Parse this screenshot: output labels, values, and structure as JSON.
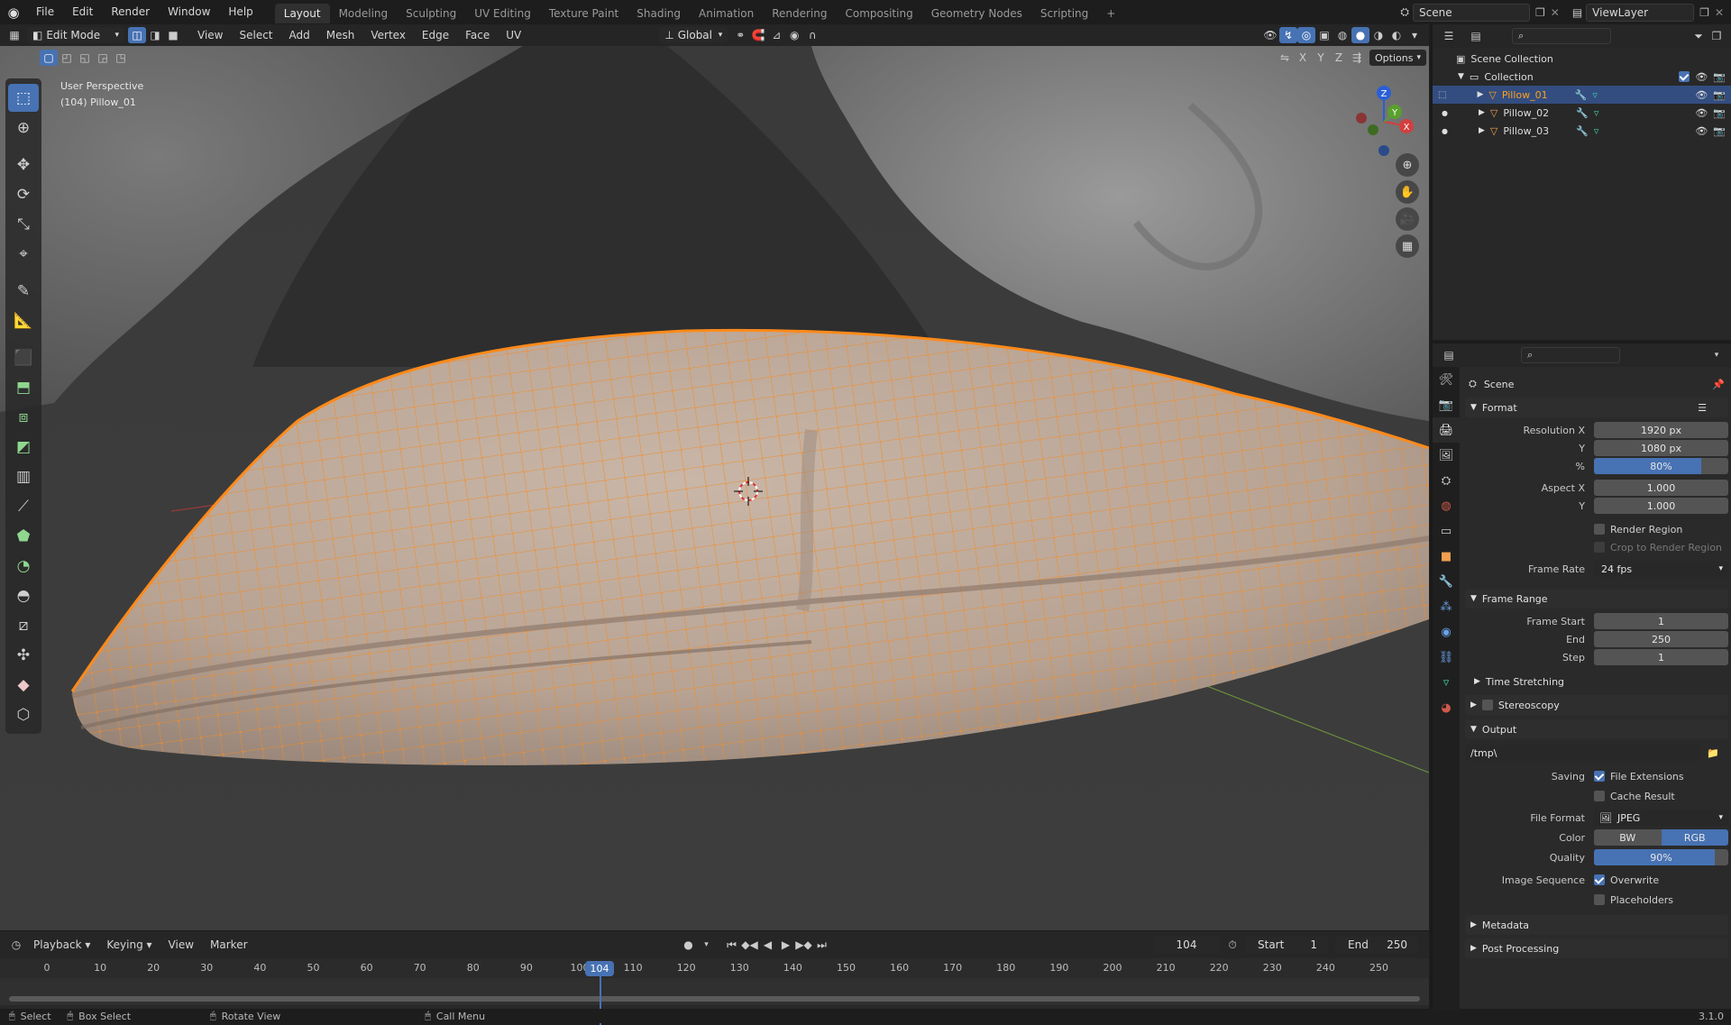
{
  "topbar": {
    "menus": [
      "File",
      "Edit",
      "Render",
      "Window",
      "Help"
    ],
    "workspaces": [
      "Layout",
      "Modeling",
      "Sculpting",
      "UV Editing",
      "Texture Paint",
      "Shading",
      "Animation",
      "Rendering",
      "Compositing",
      "Geometry Nodes",
      "Scripting"
    ],
    "active_workspace": "Layout",
    "add_tab": "+",
    "scene_name": "Scene",
    "view_layer": "ViewLayer"
  },
  "viewport": {
    "mode": "Edit Mode",
    "menus": [
      "View",
      "Select",
      "Add",
      "Mesh",
      "Vertex",
      "Edge",
      "Face",
      "UV"
    ],
    "transform_orientation": "Global",
    "options_label": "Options",
    "axis_lock": [
      "X",
      "Y",
      "Z"
    ],
    "info_line1": "User Perspective",
    "info_line2": "(104) Pillow_01",
    "gizmo_labels": {
      "z": "Z",
      "y": "Y",
      "x": "X"
    }
  },
  "outliner": {
    "scene_collection": "Scene Collection",
    "collection": "Collection",
    "objects": [
      "Pillow_01",
      "Pillow_02",
      "Pillow_03"
    ],
    "selected": "Pillow_01"
  },
  "properties": {
    "context": "Scene",
    "format": {
      "title": "Format",
      "resolution_x_label": "Resolution X",
      "resolution_x": "1920 px",
      "resolution_y_label": "Y",
      "resolution_y": "1080 px",
      "percent_label": "%",
      "percent": "80%",
      "percent_fill": 0.8,
      "aspect_x_label": "Aspect X",
      "aspect_x": "1.000",
      "aspect_y_label": "Y",
      "aspect_y": "1.000",
      "render_region": "Render Region",
      "crop_region": "Crop to Render Region",
      "frame_rate_label": "Frame Rate",
      "frame_rate": "24 fps"
    },
    "frame_range": {
      "title": "Frame Range",
      "start_label": "Frame Start",
      "start": "1",
      "end_label": "End",
      "end": "250",
      "step_label": "Step",
      "step": "1",
      "time_stretching": "Time Stretching"
    },
    "stereoscopy": "Stereoscopy",
    "output": {
      "title": "Output",
      "path": "/tmp\\",
      "saving_label": "Saving",
      "file_extensions": "File Extensions",
      "cache_result": "Cache Result",
      "file_format_label": "File Format",
      "file_format": "JPEG",
      "color_label": "Color",
      "color_bw": "BW",
      "color_rgb": "RGB",
      "quality_label": "Quality",
      "quality": "90%",
      "quality_fill": 0.9,
      "image_sequence_label": "Image Sequence",
      "overwrite": "Overwrite",
      "placeholders": "Placeholders"
    },
    "metadata": "Metadata",
    "post_processing": "Post Processing"
  },
  "timeline": {
    "menus": [
      "Playback",
      "Keying",
      "View",
      "Marker"
    ],
    "current_frame": "104",
    "start_label": "Start",
    "start": "1",
    "end_label": "End",
    "end": "250",
    "ticks": [
      "0",
      "10",
      "20",
      "30",
      "40",
      "50",
      "60",
      "70",
      "80",
      "90",
      "100",
      "110",
      "120",
      "130",
      "140",
      "150",
      "160",
      "170",
      "180",
      "190",
      "200",
      "210",
      "220",
      "230",
      "240",
      "250"
    ],
    "playhead_label": "104"
  },
  "statusbar": {
    "items": [
      "Select",
      "Box Select",
      "Rotate View",
      "Call Menu"
    ],
    "version": "3.1.0"
  },
  "colors": {
    "accent": "#4772b3",
    "mesh_orange": "#f08a24",
    "active_outline": "#ffa11a"
  }
}
